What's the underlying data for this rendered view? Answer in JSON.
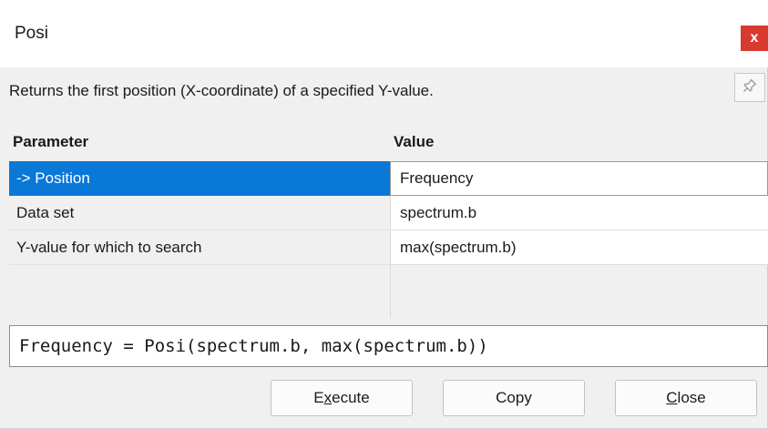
{
  "window": {
    "title": "Posi",
    "close_glyph": "x"
  },
  "description": "Returns the first position (X-coordinate) of a specified Y-value.",
  "pin_icon": "pin-icon",
  "table": {
    "headers": {
      "parameter": "Parameter",
      "value": "Value"
    },
    "rows": [
      {
        "parameter": "-> Position",
        "value": "Frequency",
        "selected": true
      },
      {
        "parameter": "Data set",
        "value": "spectrum.b",
        "selected": false
      },
      {
        "parameter": "Y-value for which to search",
        "value": "max(spectrum.b)",
        "selected": false
      }
    ]
  },
  "formula": "Frequency = Posi(spectrum.b, max(spectrum.b))",
  "buttons": {
    "execute": {
      "pre": "E",
      "mnemonic": "x",
      "post": "ecute"
    },
    "copy": "Copy",
    "close": {
      "mnemonic": "C",
      "post": "lose"
    }
  },
  "colors": {
    "selection": "#0a78d7",
    "close_button": "#d83a2f"
  }
}
